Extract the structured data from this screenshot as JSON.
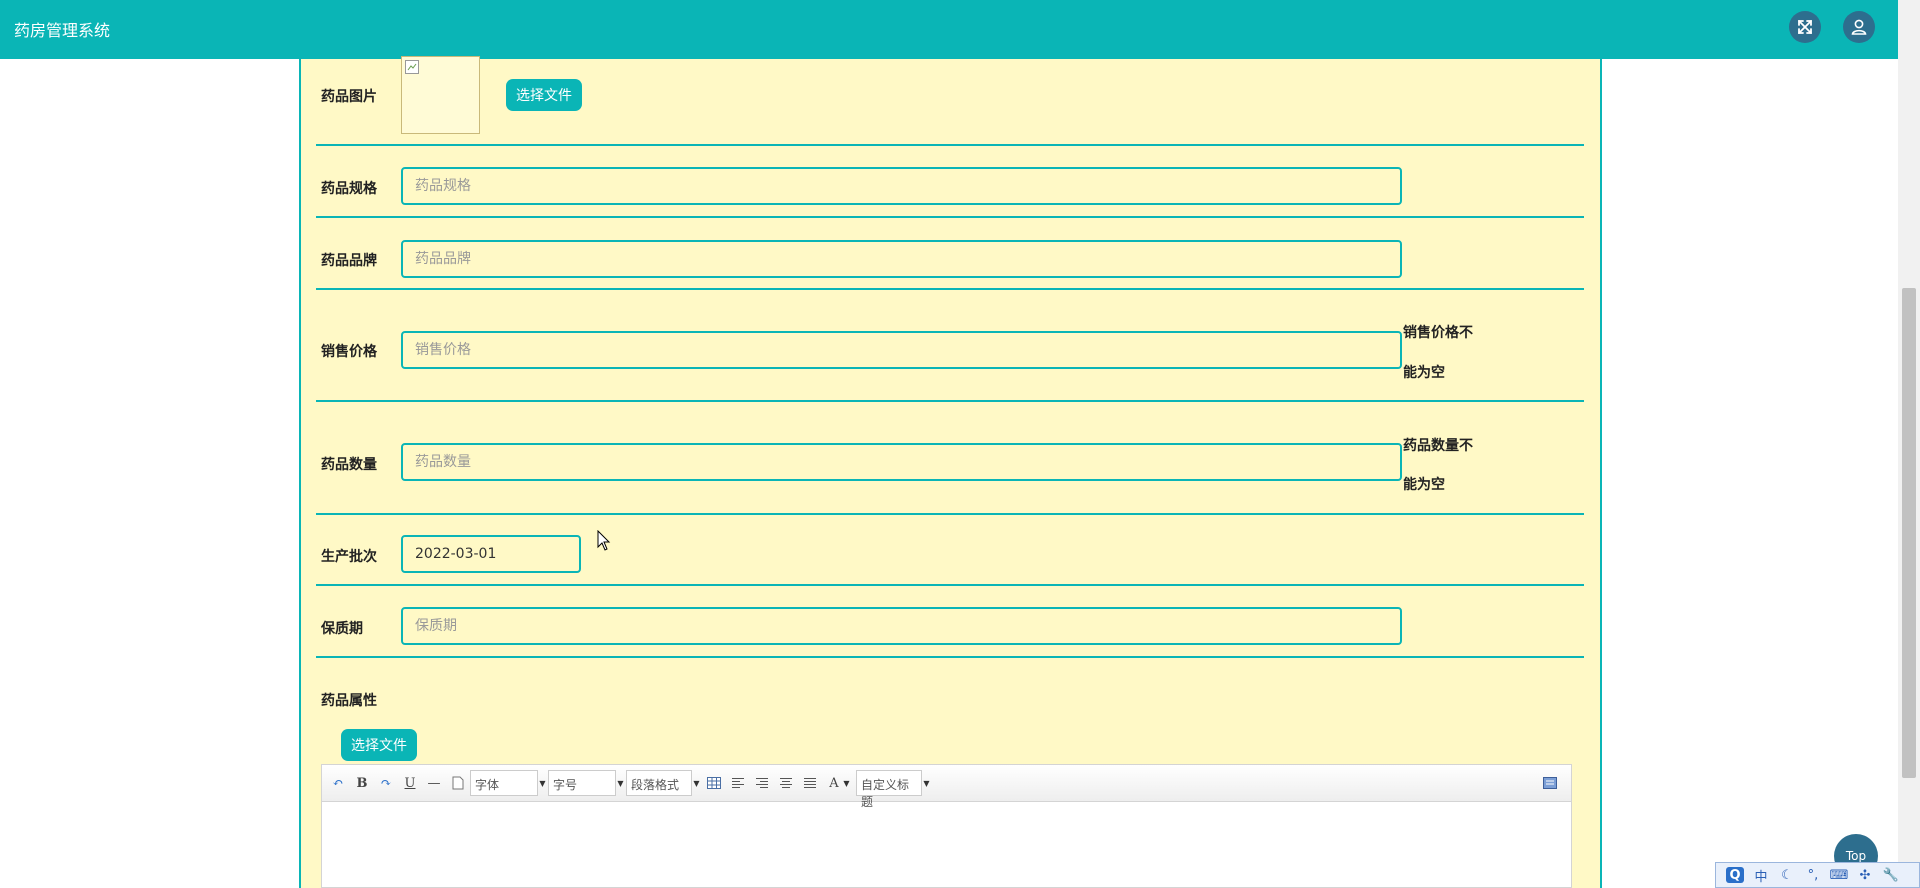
{
  "header": {
    "app_title": "药房管理系统"
  },
  "form": {
    "image": {
      "label": "药品图片",
      "button": "选择文件"
    },
    "spec": {
      "label": "药品规格",
      "placeholder": "药品规格",
      "value": ""
    },
    "brand": {
      "label": "药品品牌",
      "placeholder": "药品品牌",
      "value": ""
    },
    "price": {
      "label": "销售价格",
      "placeholder": "销售价格",
      "value": "",
      "error_line1": "销售价格不",
      "error_line2": "能为空"
    },
    "quantity": {
      "label": "药品数量",
      "placeholder": "药品数量",
      "value": "",
      "error_line1": "药品数量不",
      "error_line2": "能为空"
    },
    "batch": {
      "label": "生产批次",
      "value": "2022-03-01"
    },
    "shelf_life": {
      "label": "保质期",
      "placeholder": "保质期",
      "value": ""
    },
    "attributes": {
      "label": "药品属性",
      "button": "选择文件",
      "editor": {
        "bold": "B",
        "underline": "U",
        "font_family": "字体",
        "font_size": "字号",
        "paragraph": "段落格式",
        "font_color": "A",
        "custom_title": "自定义标题"
      }
    }
  },
  "floating": {
    "top_button": "Top"
  },
  "ime": {
    "mode": "中"
  },
  "colors": {
    "accent": "#0ab5b6",
    "panel_bg": "#fff9c6",
    "round_button": "#2d6e8e"
  }
}
